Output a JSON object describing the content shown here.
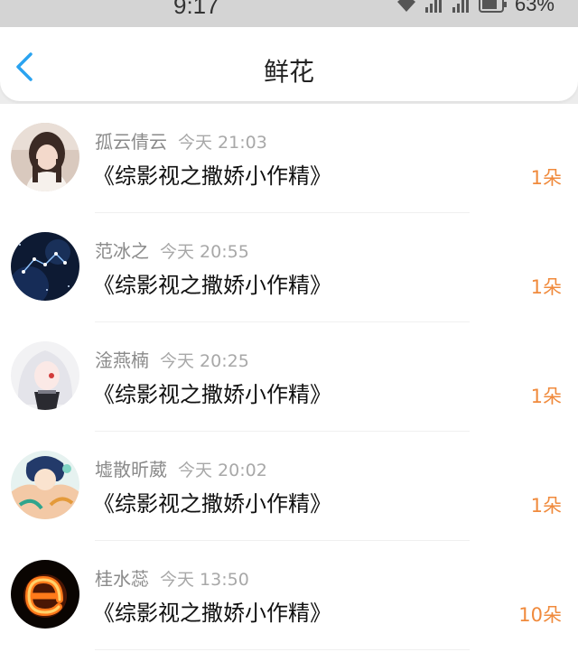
{
  "status_bar": {
    "time": "9:17",
    "battery_percent": "63%"
  },
  "header": {
    "title": "鲜花",
    "back_icon": "chevron-left-icon"
  },
  "colors": {
    "accent": "#2aa3f0",
    "count": "#f08a3c"
  },
  "items": [
    {
      "user": "孤云倩云",
      "time": "今天 21:03",
      "book": "《综影视之撒娇小作精》",
      "count": "1朵",
      "avatar": "portrait-girl-avatar"
    },
    {
      "user": "范冰之",
      "time": "今天 20:55",
      "book": "《综影视之撒娇小作精》",
      "count": "1朵",
      "avatar": "constellation-avatar"
    },
    {
      "user": "淦燕楠",
      "time": "今天 20:25",
      "book": "《综影视之撒娇小作精》",
      "count": "1朵",
      "avatar": "anime-white-hair-avatar"
    },
    {
      "user": "墟散昕葳",
      "time": "今天 20:02",
      "book": "《综影视之撒娇小作精》",
      "count": "1朵",
      "avatar": "anime-character-avatar"
    },
    {
      "user": "桂水蕊",
      "time": "今天 13:50",
      "book": "《综影视之撒娇小作精》",
      "count": "10朵",
      "avatar": "fire-letter-avatar"
    }
  ]
}
